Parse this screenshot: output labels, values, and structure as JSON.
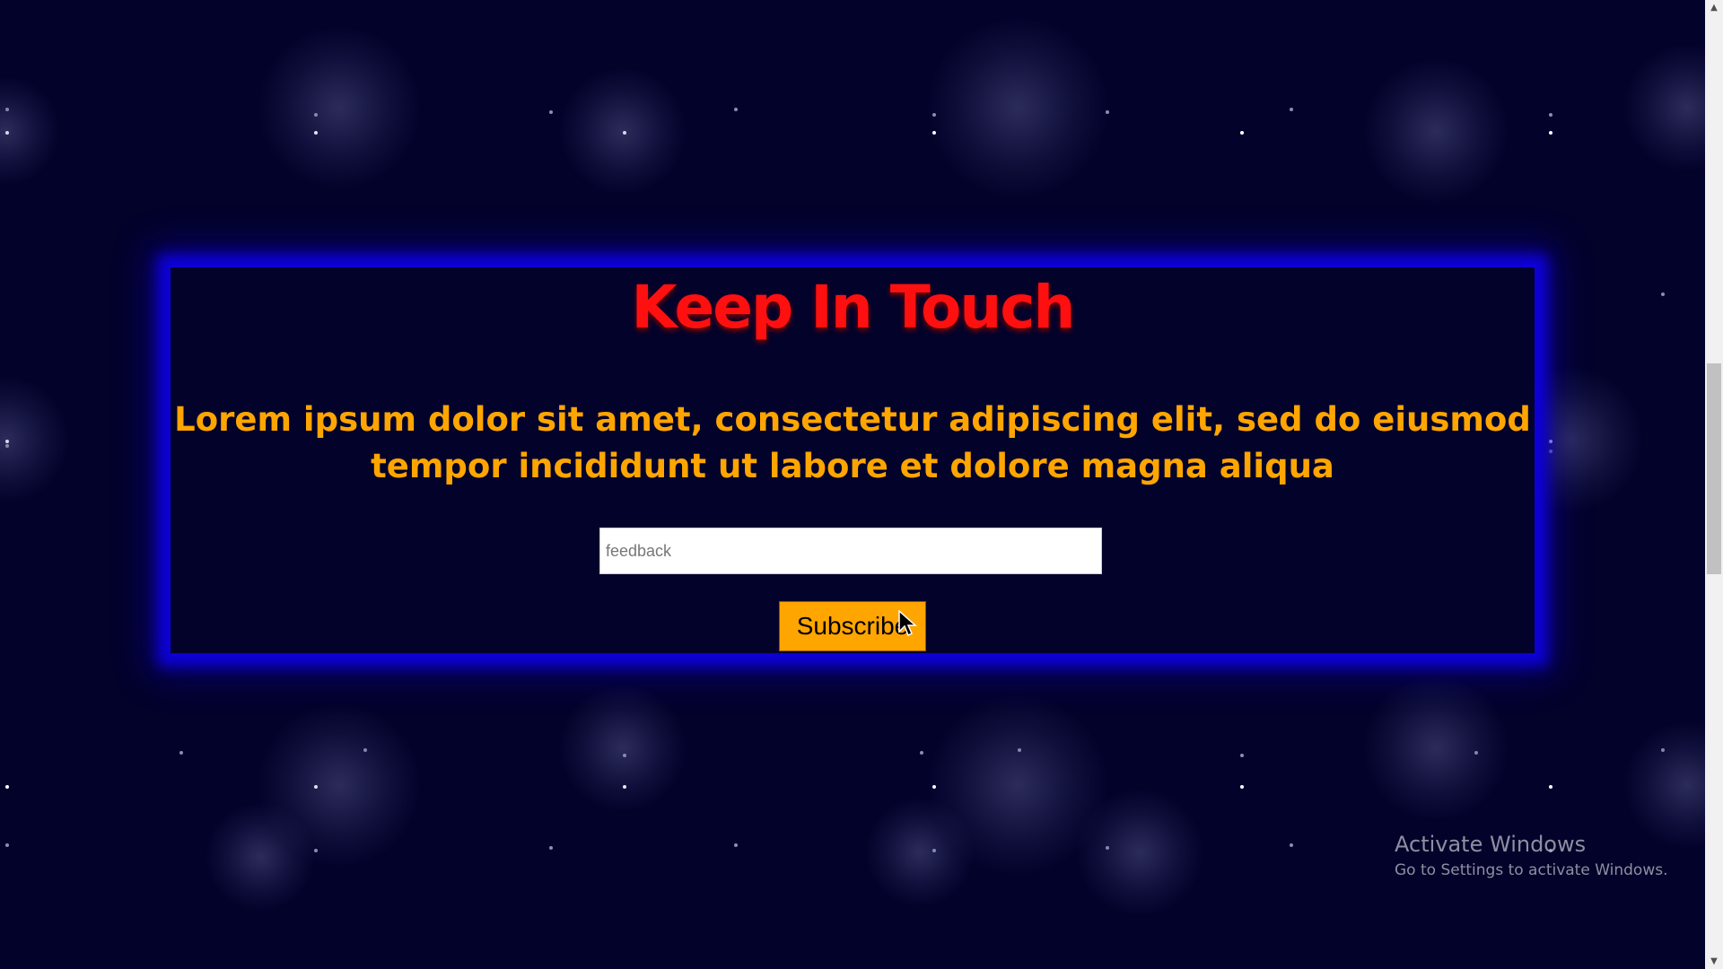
{
  "contact": {
    "title": "Keep In Touch",
    "description": "Lorem ipsum dolor sit amet, consectetur adipiscing elit, sed do eiusmod tempor incididunt ut labore et dolore magna aliqua",
    "feedback_placeholder": "feedback",
    "subscribe_label": "Subscribe"
  },
  "watermark": {
    "title": "Activate Windows",
    "subtitle": "Go to Settings to activate Windows."
  },
  "scrollbar": {
    "up_arrow": "▲",
    "down_arrow": "▼"
  },
  "colors": {
    "background": "#03022b",
    "title": "#ff1010",
    "description": "#ffa500",
    "button": "#ffa500",
    "box_glow": "#0d00d9"
  },
  "icons": {
    "cursor": "mouse-pointer-icon"
  }
}
